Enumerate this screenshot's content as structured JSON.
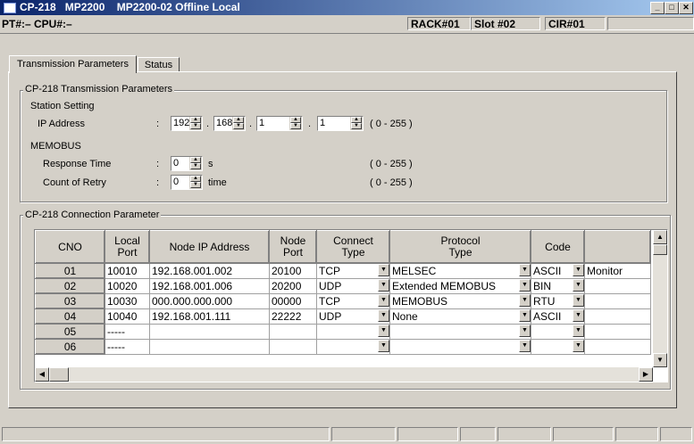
{
  "title": {
    "app": "CP-218",
    "model": "MP2200",
    "text": "MP2200-02 Offline Local"
  },
  "infobar": {
    "pt_cpu": "PT#:– CPU#:–",
    "rack": "RACK#01",
    "slot": "Slot #02",
    "cir": "CIR#01"
  },
  "tabs": [
    "Transmission Parameters",
    "Status"
  ],
  "transmission": {
    "group_label": "CP-218 Transmission Parameters",
    "station_setting": "Station Setting",
    "ip_label": "IP Address",
    "colon": ":",
    "ip": [
      "192",
      "168",
      "1",
      "1"
    ],
    "dot": ".",
    "range": "( 0 - 255 )",
    "memobus": "MEMOBUS",
    "response_label": "Response Time",
    "response_value": "0",
    "response_unit": "s",
    "retry_label": "Count of Retry",
    "retry_value": "0",
    "retry_unit": "time"
  },
  "connection": {
    "group_label": "CP-218 Connection Parameter",
    "headers": [
      "CNO",
      "Local\nPort",
      "Node IP Address",
      "Node\nPort",
      "Connect\nType",
      "Protocol\nType",
      "Code",
      ""
    ],
    "rows": [
      {
        "cno": "01",
        "local": "10010",
        "ip": "192.168.001.002",
        "node": "20100",
        "conn": "TCP",
        "proto": "MELSEC",
        "code": "ASCII",
        "extra": "Monitor"
      },
      {
        "cno": "02",
        "local": "10020",
        "ip": "192.168.001.006",
        "node": "20200",
        "conn": "UDP",
        "proto": "Extended MEMOBUS",
        "code": "BIN",
        "extra": ""
      },
      {
        "cno": "03",
        "local": "10030",
        "ip": "000.000.000.000",
        "node": "00000",
        "conn": "TCP",
        "proto": "MEMOBUS",
        "code": "RTU",
        "extra": ""
      },
      {
        "cno": "04",
        "local": "10040",
        "ip": "192.168.001.111",
        "node": "22222",
        "conn": "UDP",
        "proto": "None",
        "code": "ASCII",
        "extra": ""
      },
      {
        "cno": "05",
        "local": "-----",
        "ip": "",
        "node": "",
        "conn": "",
        "proto": "",
        "code": "",
        "extra": ""
      },
      {
        "cno": "06",
        "local": "-----",
        "ip": "",
        "node": "",
        "conn": "",
        "proto": "",
        "code": "",
        "extra": ""
      }
    ]
  },
  "icons": {
    "minimize": "minimize-icon",
    "maximize": "maximize-icon",
    "close": "close-icon"
  }
}
